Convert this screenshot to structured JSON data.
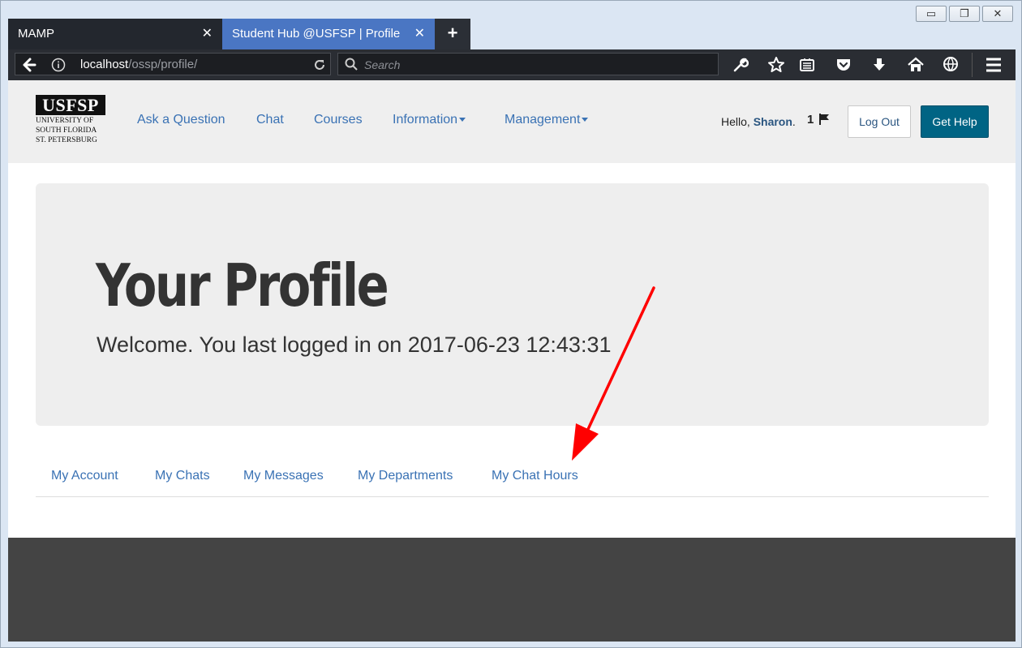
{
  "window": {
    "controls": {
      "minimize": "▭",
      "maximize": "❐",
      "close": "✕"
    }
  },
  "browser": {
    "tabs": [
      {
        "label": "MAMP",
        "close": "✕"
      },
      {
        "label": "Student Hub @USFSP | Profile",
        "close": "✕"
      }
    ],
    "new_tab": "+",
    "url_host": "localhost",
    "url_path": "/ossp/profile/",
    "search_placeholder": "Search"
  },
  "site": {
    "logo": {
      "mark": "USFSP",
      "line1": "UNIVERSITY OF",
      "line2": "SOUTH FLORIDA",
      "line3": "ST. PETERSBURG"
    },
    "nav": {
      "ask": "Ask a Question",
      "chat": "Chat",
      "courses": "Courses",
      "information": "Information",
      "management": "Management"
    },
    "user": {
      "greeting": "Hello, ",
      "name": "Sharon",
      "period": ".",
      "flag_count": "1"
    },
    "buttons": {
      "logout": "Log Out",
      "help": "Get Help"
    },
    "profile": {
      "title": "Your Profile",
      "welcome": "Welcome. You last logged in on 2017-06-23 12:43:31"
    },
    "profile_tabs": [
      "My Account",
      "My Chats",
      "My Messages",
      "My Departments",
      "My Chat Hours"
    ]
  },
  "colors": {
    "link": "#3a72b4",
    "help_button": "#006484",
    "annotation_arrow": "#ff0000"
  }
}
